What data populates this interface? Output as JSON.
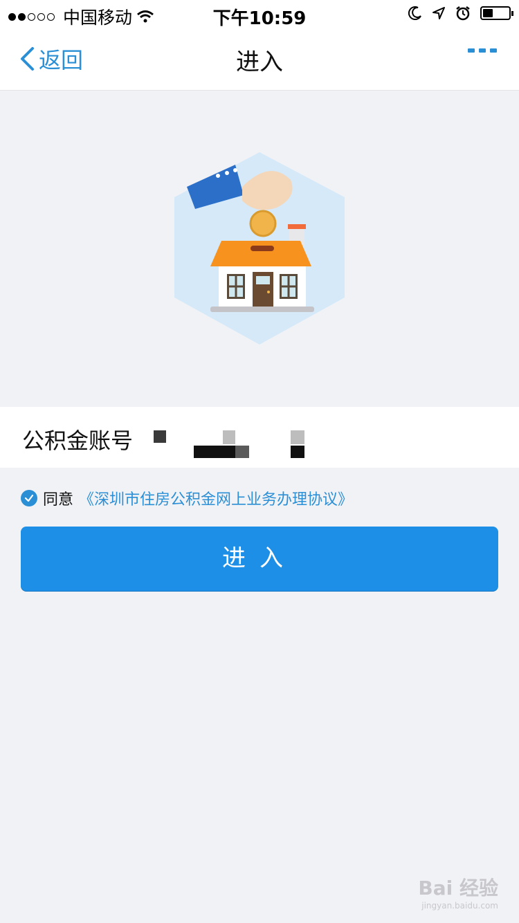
{
  "status_bar": {
    "carrier": "中国移动",
    "time": "下午10:59"
  },
  "nav": {
    "back_label": "返回",
    "title": "进入"
  },
  "form": {
    "account_label": "公积金账号",
    "account_value": ""
  },
  "agreement": {
    "prefix": "同意",
    "link": "《深圳市住房公积金网上业务办理协议》",
    "checked": true
  },
  "primary_button": {
    "label": "进入"
  },
  "watermark": {
    "main": "Bai 经验",
    "sub": "jingyan.baidu.com"
  },
  "colors": {
    "accent": "#1e8fe6",
    "link": "#2b8fd6",
    "background": "#f1f2f6"
  }
}
